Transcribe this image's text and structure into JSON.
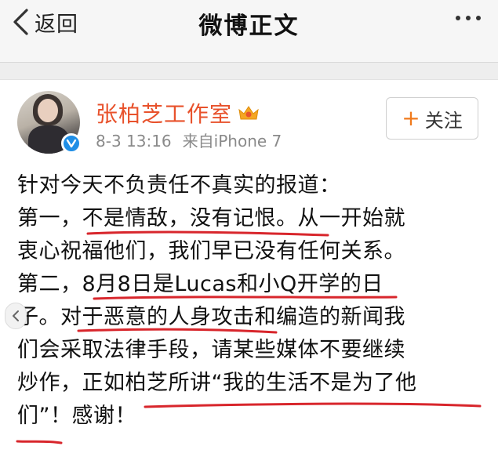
{
  "header": {
    "back_label": "返回",
    "title": "微博正文"
  },
  "post": {
    "author": "张柏芝工作室",
    "date": "8-3 13:16",
    "source": "来自iPhone 7",
    "follow_label": "关注",
    "lines": [
      "针对今天不负责任不真实的报道：",
      "第一，不是情敌，没有记恨。从一开始就",
      "衷心祝福他们，我们早已没有任何关系。",
      "第二，8月8日是Lucas和小Q开学的日",
      "子。对于恶意的人身攻击和编造的新闻我",
      "们会采取法律手段，请某些媒体不要继续",
      "炒作，正如柏芝所讲“我的生活不是为了他",
      "们”！感谢！"
    ]
  },
  "colors": {
    "author": "#e8522c",
    "annotation": "#d8262c",
    "verified": "#1f8ee6"
  },
  "icons": [
    "chevron-left-icon",
    "more-dots-icon",
    "verified-badge-icon",
    "crown-icon",
    "plus-icon",
    "chevron-left-circle-icon"
  ]
}
